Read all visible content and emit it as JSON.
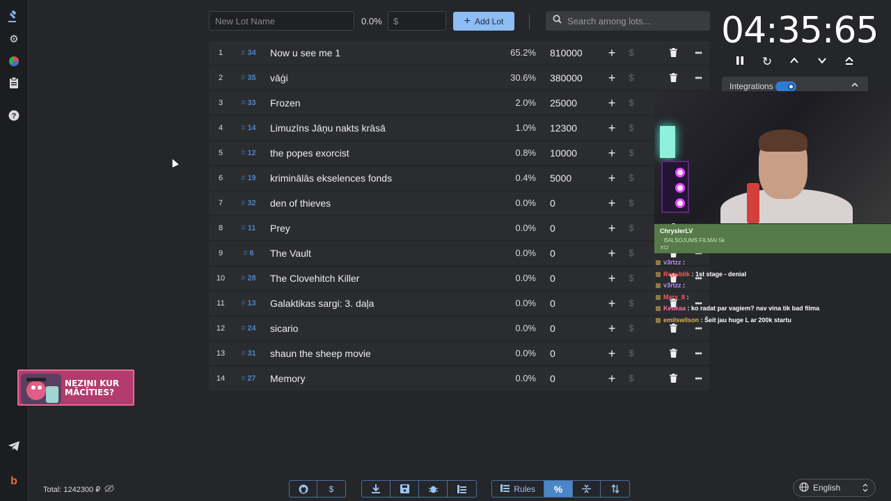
{
  "toolbar": {
    "lot_name_placeholder": "New Lot Name",
    "percent": "0.0%",
    "amount_placeholder": "$",
    "add_lot_label": "Add Lot",
    "search_placeholder": "Search among lots..."
  },
  "lots": [
    {
      "idx": "1",
      "id": "34",
      "name": "Now u see me 1",
      "pct": "65.2%",
      "amount": "810000"
    },
    {
      "idx": "2",
      "id": "35",
      "name": "vāģi",
      "pct": "30.6%",
      "amount": "380000"
    },
    {
      "idx": "3",
      "id": "33",
      "name": "Frozen",
      "pct": "2.0%",
      "amount": "25000"
    },
    {
      "idx": "4",
      "id": "14",
      "name": "Limuzīns Jāņu nakts krāsā",
      "pct": "1.0%",
      "amount": "12300"
    },
    {
      "idx": "5",
      "id": "12",
      "name": "the popes exorcist",
      "pct": "0.8%",
      "amount": "10000"
    },
    {
      "idx": "6",
      "id": "19",
      "name": "kriminālās ekselences fonds",
      "pct": "0.4%",
      "amount": "5000"
    },
    {
      "idx": "7",
      "id": "32",
      "name": "den of thieves",
      "pct": "0.0%",
      "amount": "0"
    },
    {
      "idx": "8",
      "id": "11",
      "name": "Prey",
      "pct": "0.0%",
      "amount": "0"
    },
    {
      "idx": "9",
      "id": "6",
      "name": "The Vault",
      "pct": "0.0%",
      "amount": "0"
    },
    {
      "idx": "10",
      "id": "28",
      "name": "The Clovehitch Killer",
      "pct": "0.0%",
      "amount": "0"
    },
    {
      "idx": "11",
      "id": "13",
      "name": "Galaktikas sargi: 3. daļa",
      "pct": "0.0%",
      "amount": "0"
    },
    {
      "idx": "12",
      "id": "24",
      "name": "sicario",
      "pct": "0.0%",
      "amount": "0"
    },
    {
      "idx": "13",
      "id": "31",
      "name": "shaun the sheep movie",
      "pct": "0.0%",
      "amount": "0"
    },
    {
      "idx": "14",
      "id": "27",
      "name": "Memory",
      "pct": "0.0%",
      "amount": "0"
    }
  ],
  "timer": {
    "display": "04:35:65"
  },
  "integrations": {
    "label": "Integrations"
  },
  "alert": {
    "name": "ChryslerLV",
    "line": "BALSOJUMS FILMAI 5k",
    "num": "#12"
  },
  "chat": [
    {
      "user": "v3rtzz",
      "user_color": "#b98cff",
      "text": ""
    },
    {
      "user": "Republik",
      "user_color": "#ff5a5a",
      "text": "1st stage - denial"
    },
    {
      "user": "v3rtzz",
      "user_color": "#b98cff",
      "text": ""
    },
    {
      "user": "Marx_8",
      "user_color": "#ff5a5a",
      "text": ""
    },
    {
      "user": "Keukaa",
      "user_color": "#ff6fa0",
      "text": "ko radat par vagiem? nav vina tik bad filma"
    },
    {
      "user": "emilswilson",
      "user_color": "#e0b34a",
      "text": "Šeit jau huge L ar 200k startu"
    }
  ],
  "promo": {
    "line1": "NEZINI KUR",
    "line2": "MĀCĪTIES?"
  },
  "footer": {
    "total": "Total: 1242300 ₽",
    "rules_label": "Rules",
    "language": "English"
  },
  "colors": {
    "accent": "#4a86c8",
    "add_button": "#8fbcf2",
    "background": "#252629",
    "row": "#2b2c30"
  }
}
